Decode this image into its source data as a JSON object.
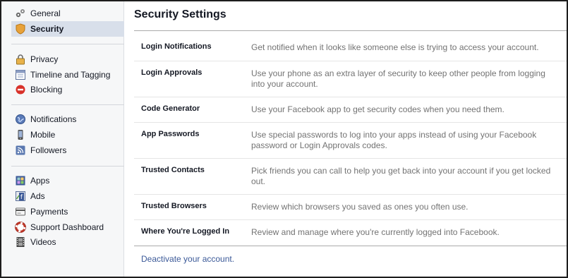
{
  "sidebar": {
    "items": [
      {
        "label": "General",
        "icon": "gears-icon"
      },
      {
        "label": "Security",
        "icon": "shield-icon",
        "active": true
      },
      {
        "label": "Privacy",
        "icon": "lock-icon"
      },
      {
        "label": "Timeline and Tagging",
        "icon": "timeline-icon"
      },
      {
        "label": "Blocking",
        "icon": "block-icon"
      },
      {
        "label": "Notifications",
        "icon": "globe-icon"
      },
      {
        "label": "Mobile",
        "icon": "phone-icon"
      },
      {
        "label": "Followers",
        "icon": "rss-icon"
      },
      {
        "label": "Apps",
        "icon": "apps-icon"
      },
      {
        "label": "Ads",
        "icon": "ads-icon"
      },
      {
        "label": "Payments",
        "icon": "card-icon"
      },
      {
        "label": "Support Dashboard",
        "icon": "lifebuoy-icon"
      },
      {
        "label": "Videos",
        "icon": "film-icon"
      }
    ]
  },
  "main": {
    "title": "Security Settings",
    "rows": [
      {
        "label": "Login Notifications",
        "desc": "Get notified when it looks like someone else is trying to access your account."
      },
      {
        "label": "Login Approvals",
        "desc": "Use your phone as an extra layer of security to keep other people from logging into your account."
      },
      {
        "label": "Code Generator",
        "desc": "Use your Facebook app to get security codes when you need them."
      },
      {
        "label": "App Passwords",
        "desc": "Use special passwords to log into your apps instead of using your Facebook password or Login Approvals codes."
      },
      {
        "label": "Trusted Contacts",
        "desc": "Pick friends you can call to help you get back into your account if you get locked out."
      },
      {
        "label": "Trusted Browsers",
        "desc": "Review which browsers you saved as ones you often use."
      },
      {
        "label": "Where You're Logged In",
        "desc": "Review and manage where you're currently logged into Facebook."
      }
    ],
    "deactivate": "Deactivate your account."
  },
  "colors": {
    "link": "#3b5998",
    "active_bg": "#d8dfea",
    "sidebar_bg": "#f6f7f8",
    "desc_text": "#737373"
  }
}
